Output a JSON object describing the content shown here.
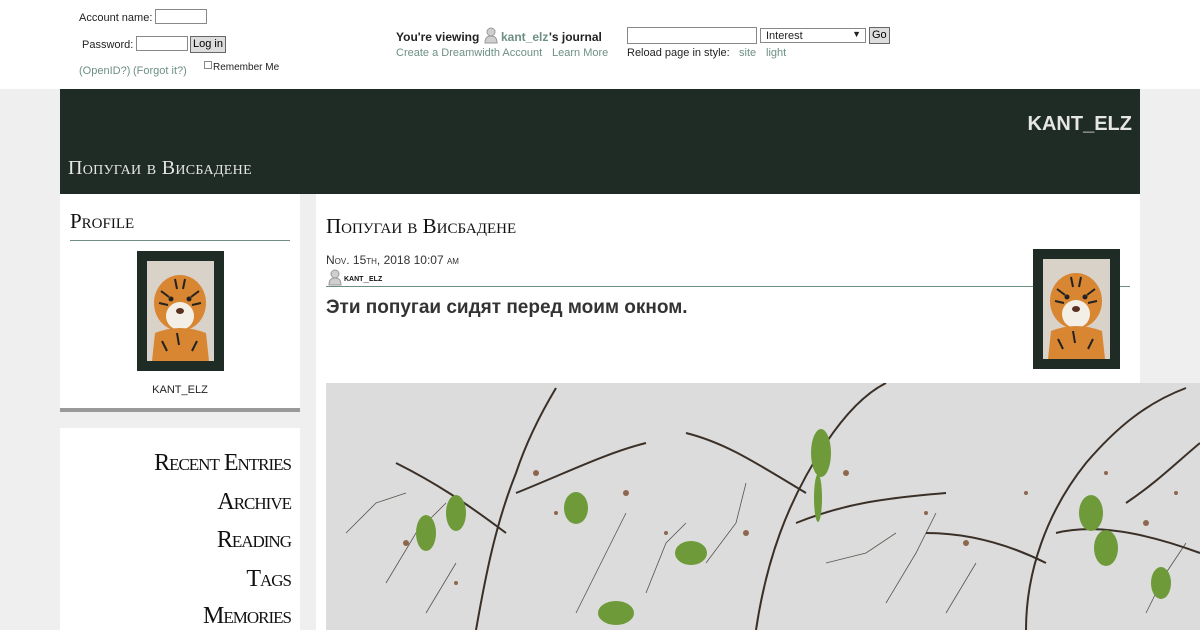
{
  "login": {
    "account_label": "Account name:",
    "password_label": "Password:",
    "login_button": "Log in",
    "openid_link": "(OpenID?)",
    "forgot_link": "(Forgot it?)",
    "remember_label": "Remember Me"
  },
  "viewing": {
    "prefix": "You're viewing ",
    "user": "kant_elz",
    "suffix": "'s journal",
    "create_link": "Create a Dreamwidth Account",
    "learn_link": "Learn More"
  },
  "search": {
    "select_value": "Interest",
    "go_button": "Go",
    "reload_label": "Reload page in style:",
    "style_site": "site",
    "style_light": "light"
  },
  "header": {
    "journal_name": "KANT_ELZ",
    "title": "Попугаи в Висбадене"
  },
  "profile": {
    "heading": "Profile",
    "username": "KANT_ELZ"
  },
  "nav": {
    "items": [
      "Recent Entries",
      "Archive",
      "Reading",
      "Tags",
      "Memories"
    ]
  },
  "entry": {
    "title": "Попугаи в Висбадене",
    "date": "Nov. 15th, 2018 10:07 am",
    "poster": "kant_elz",
    "text": "Эти попугаи сидят перед моим окном."
  },
  "colors": {
    "header_bg": "#1f2b25",
    "link": "#6d8f82",
    "page_bg": "#efefef"
  }
}
